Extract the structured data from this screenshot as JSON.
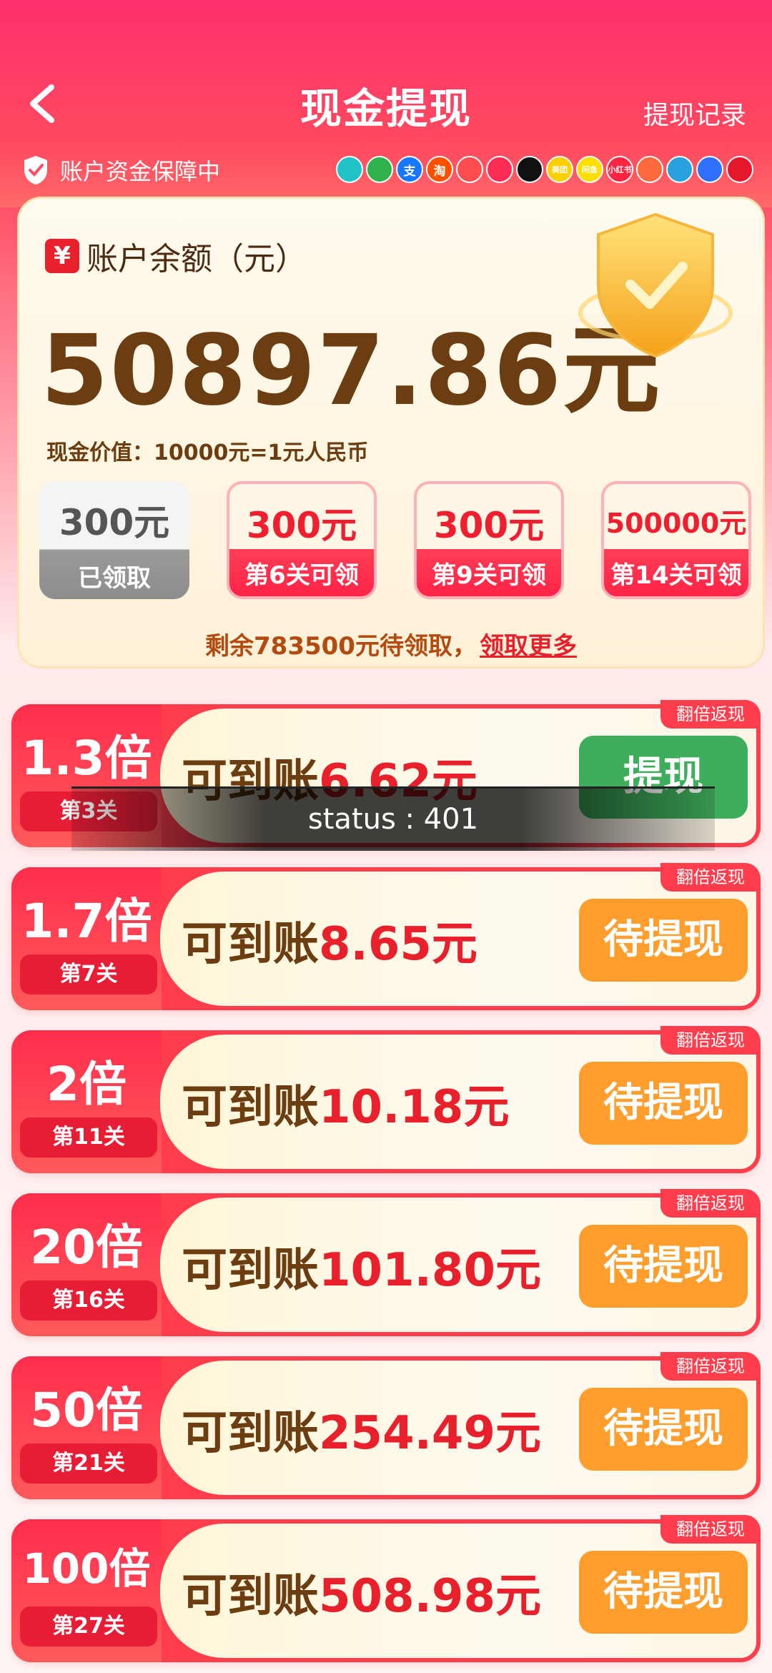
{
  "header": {
    "title": "现金提现",
    "record_link": "提现记录",
    "security_text": "账户资金保障中"
  },
  "brands": [
    {
      "icon": "tiktok-icon",
      "label": "",
      "color": "#22c3c8"
    },
    {
      "icon": "wechat-icon",
      "label": "",
      "color": "#2fb24c"
    },
    {
      "icon": "alipay-icon",
      "label": "支",
      "color": "#1677ff"
    },
    {
      "icon": "taobao-icon",
      "label": "淘",
      "color": "#ff5000"
    },
    {
      "icon": "bird-icon",
      "label": "",
      "color": "#ff4d4f"
    },
    {
      "icon": "lotus-icon",
      "label": "",
      "color": "#ff2d55"
    },
    {
      "icon": "douyin-icon",
      "label": "",
      "color": "#111111"
    },
    {
      "icon": "meituan-icon",
      "label": "美团",
      "color": "#ffd000"
    },
    {
      "icon": "xianyu-icon",
      "label": "闲鱼",
      "color": "#ffde00"
    },
    {
      "icon": "xiaohongshu-icon",
      "label": "小红书",
      "color": "#ff2442"
    },
    {
      "icon": "flower-icon",
      "label": "",
      "color": "#ff6a3d"
    },
    {
      "icon": "telegram-icon",
      "label": "",
      "color": "#2aa1df"
    },
    {
      "icon": "paw-icon",
      "label": "",
      "color": "#2f6fff"
    },
    {
      "icon": "weibo-icon",
      "label": "",
      "color": "#e6162d"
    }
  ],
  "account": {
    "label": "账户余额（元）",
    "yen_symbol": "¥",
    "balance": "50897.86元",
    "rate_text": "现金价值：10000元=1元人民币"
  },
  "rewards": [
    {
      "amount": "300元",
      "status": "已领取",
      "state": "claimed"
    },
    {
      "amount": "300元",
      "status": "第6关可领",
      "state": "open"
    },
    {
      "amount": "300元",
      "status": "第9关可领",
      "state": "open"
    },
    {
      "amount": "500000元",
      "status": "第14关可领",
      "state": "open"
    }
  ],
  "remain": {
    "text": "剩余783500元待领取，",
    "link": "领取更多"
  },
  "rows": [
    {
      "multiplier": "1.3倍",
      "level": "第3关",
      "prefix": "可到账",
      "amount": "6.62元",
      "tag": "翻倍返现",
      "button": "提现",
      "button_state": "withdraw"
    },
    {
      "multiplier": "1.7倍",
      "level": "第7关",
      "prefix": "可到账",
      "amount": "8.65元",
      "tag": "翻倍返现",
      "button": "待提现",
      "button_state": "pending"
    },
    {
      "multiplier": "2倍",
      "level": "第11关",
      "prefix": "可到账",
      "amount": "10.18元",
      "tag": "翻倍返现",
      "button": "待提现",
      "button_state": "pending"
    },
    {
      "multiplier": "20倍",
      "level": "第16关",
      "prefix": "可到账",
      "amount": "101.80元",
      "tag": "翻倍返现",
      "button": "待提现",
      "button_state": "pending"
    },
    {
      "multiplier": "50倍",
      "level": "第21关",
      "prefix": "可到账",
      "amount": "254.49元",
      "tag": "翻倍返现",
      "button": "待提现",
      "button_state": "pending"
    },
    {
      "multiplier": "100倍",
      "level": "第27关",
      "prefix": "可到账",
      "amount": "508.98元",
      "tag": "翻倍返现",
      "button": "待提现",
      "button_state": "pending"
    }
  ],
  "toast": {
    "text": "status : 401"
  },
  "colors": {
    "brand_red": "#e8202c",
    "button_green": "#3fae5c",
    "button_orange": "#ff9e2c",
    "balance_brown": "#6b3d10"
  }
}
